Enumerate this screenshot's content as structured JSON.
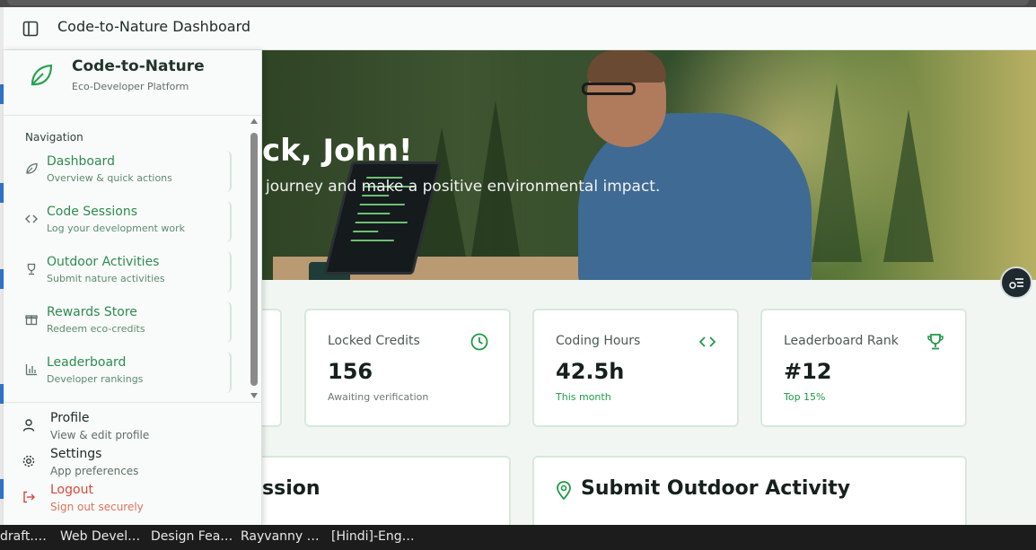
{
  "app": {
    "header_title": "Code-to-Nature Dashboard",
    "brand_name": "Code-to-Nature",
    "brand_tagline": "Eco-Developer Platform"
  },
  "hero": {
    "title": "ck, John!",
    "subtitle": "journey and make a positive environmental impact."
  },
  "stats": [
    {
      "label": "Locked Credits",
      "value": "156",
      "note": "Awaiting verification",
      "icon": "clock-icon"
    },
    {
      "label": "Coding Hours",
      "value": "42.5h",
      "note": "This month",
      "icon": "code-icon"
    },
    {
      "label": "Leaderboard Rank",
      "value": "#12",
      "note": "Top 15%",
      "icon": "trophy-icon"
    }
  ],
  "panels": {
    "session_title": "ssion",
    "outdoor_title": "Submit Outdoor Activity"
  },
  "sidebar": {
    "nav_heading": "Navigation",
    "items": [
      {
        "title": "Dashboard",
        "subtitle": "Overview & quick actions",
        "icon": "leaf-icon"
      },
      {
        "title": "Code Sessions",
        "subtitle": "Log your development work",
        "icon": "code-icon"
      },
      {
        "title": "Outdoor Activities",
        "subtitle": "Submit nature activities",
        "icon": "trophy-icon"
      },
      {
        "title": "Rewards Store",
        "subtitle": "Redeem eco-credits",
        "icon": "gift-icon"
      },
      {
        "title": "Leaderboard",
        "subtitle": "Developer rankings",
        "icon": "bar-chart-icon"
      }
    ],
    "footer": [
      {
        "title": "Profile",
        "subtitle": "View & edit profile",
        "icon": "user-icon"
      },
      {
        "title": "Settings",
        "subtitle": "App preferences",
        "icon": "gear-icon"
      },
      {
        "title": "Logout",
        "subtitle": "Sign out securely",
        "icon": "logout-icon"
      }
    ]
  },
  "taskbar": {
    "items": [
      "draft.…",
      "Web Devel…",
      "Design Fea…",
      "Rayvanny …",
      "[Hindi]-Eng…"
    ]
  },
  "colors": {
    "accent": "#1f9a47",
    "nav_text": "#2f8a50",
    "logout": "#d9473a"
  }
}
